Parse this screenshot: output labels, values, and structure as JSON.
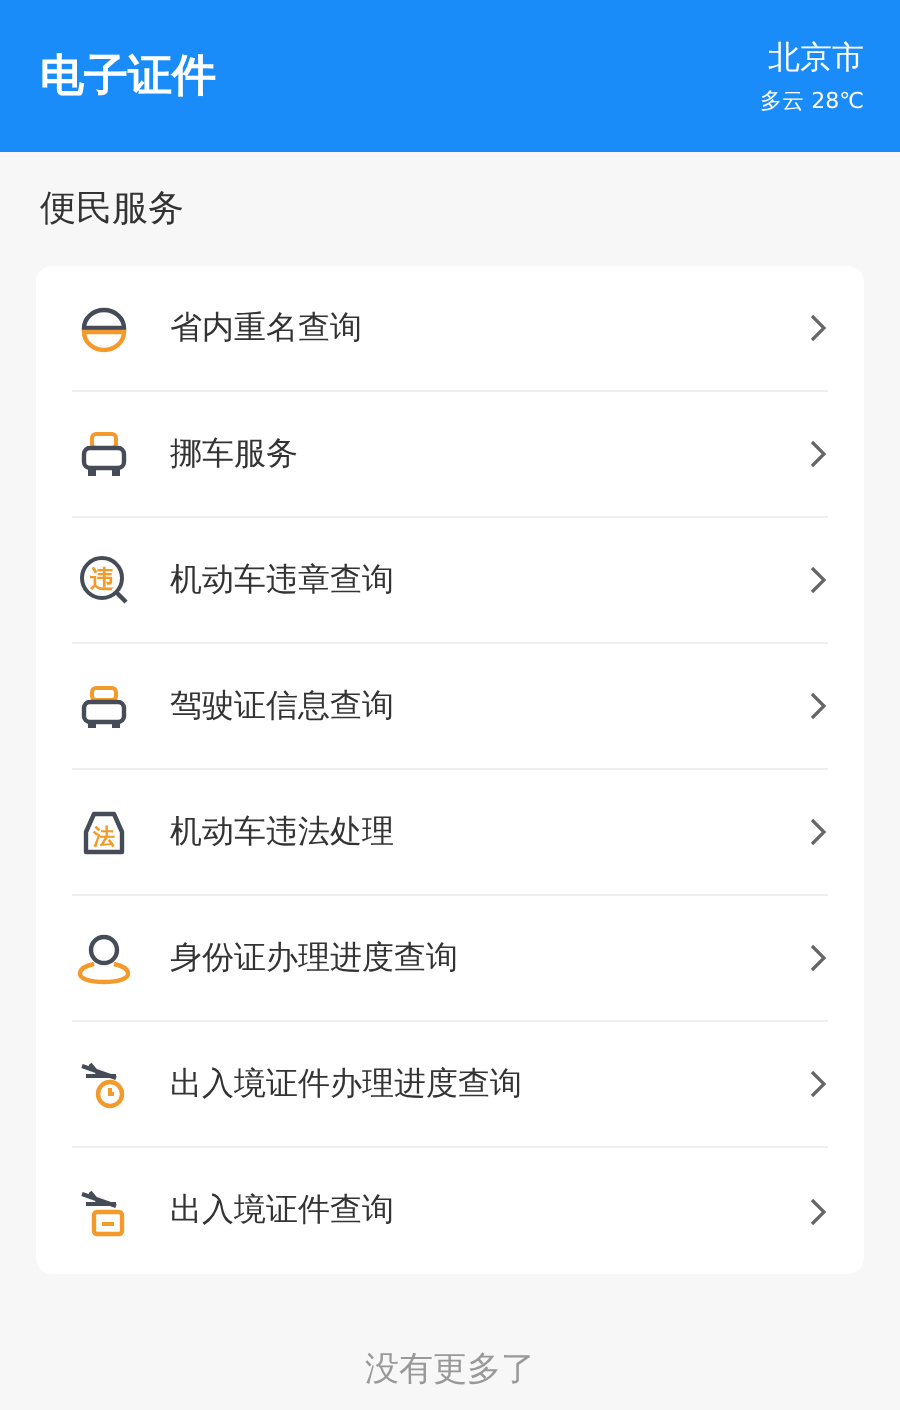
{
  "header": {
    "title": "电子证件",
    "city": "北京市",
    "weather": "多云 28℃"
  },
  "section": {
    "title": "便民服务"
  },
  "services": [
    {
      "label": "省内重名查询",
      "kind": "dome"
    },
    {
      "label": "挪车服务",
      "kind": "car"
    },
    {
      "label": "机动车违章查询",
      "kind": "magnifier",
      "icon_text": "违"
    },
    {
      "label": "驾驶证信息查询",
      "kind": "car-low"
    },
    {
      "label": "机动车违法处理",
      "kind": "car-badge",
      "icon_text": "法"
    },
    {
      "label": "身份证办理进度查询",
      "kind": "person"
    },
    {
      "label": "出入境证件办理进度查询",
      "kind": "plane-clock"
    },
    {
      "label": "出入境证件查询",
      "kind": "plane-card"
    }
  ],
  "footer": "没有更多了"
}
